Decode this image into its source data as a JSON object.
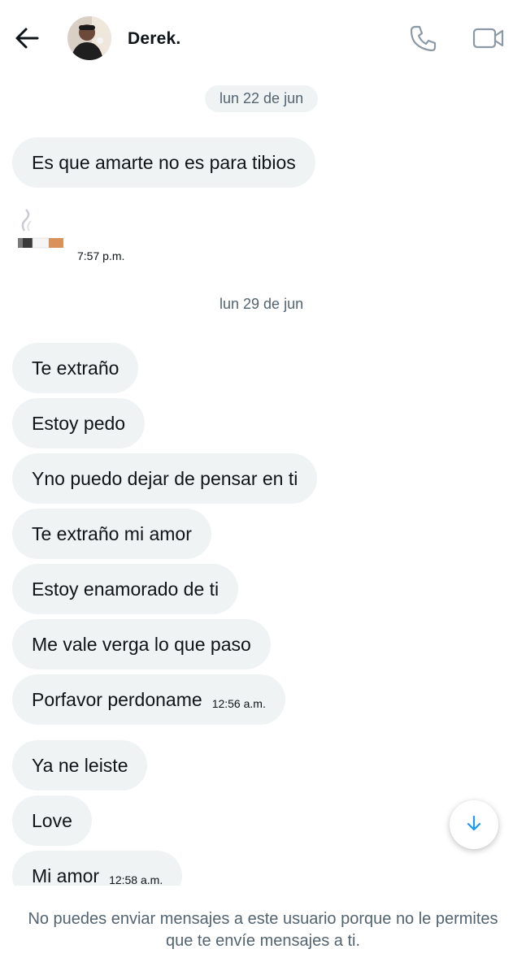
{
  "header": {
    "contact_name": "Derek.",
    "back_icon": "arrow-left-icon",
    "call_icon": "phone-icon",
    "video_icon": "video-camera-icon"
  },
  "messages": {
    "date_1": "lun 22 de jun",
    "m1": "Es que amarte no es para tibios",
    "cigarette_time": "7:57 p.m.",
    "date_2": "lun 29 de jun",
    "m2": "Te extraño",
    "m3": "Estoy pedo",
    "m4": "Yno puedo dejar de pensar en ti",
    "m5": "Te extraño mi amor",
    "m6": "Estoy enamorado de ti",
    "m7": "Me vale verga lo que paso",
    "m8": "Porfavor perdoname",
    "m8_time": "12:56 a.m.",
    "m9": "Ya ne leiste",
    "m10": "Love",
    "m11": "Mi amor",
    "m11_time": "12:58 a.m."
  },
  "footer": {
    "notice": "No puedes enviar mensajes a este usuario porque no le permites que te envíe mensajes a ti."
  },
  "colors": {
    "bubble_bg": "#eff3f4",
    "secondary_text": "#536471",
    "accent": "#1d9bf0"
  }
}
